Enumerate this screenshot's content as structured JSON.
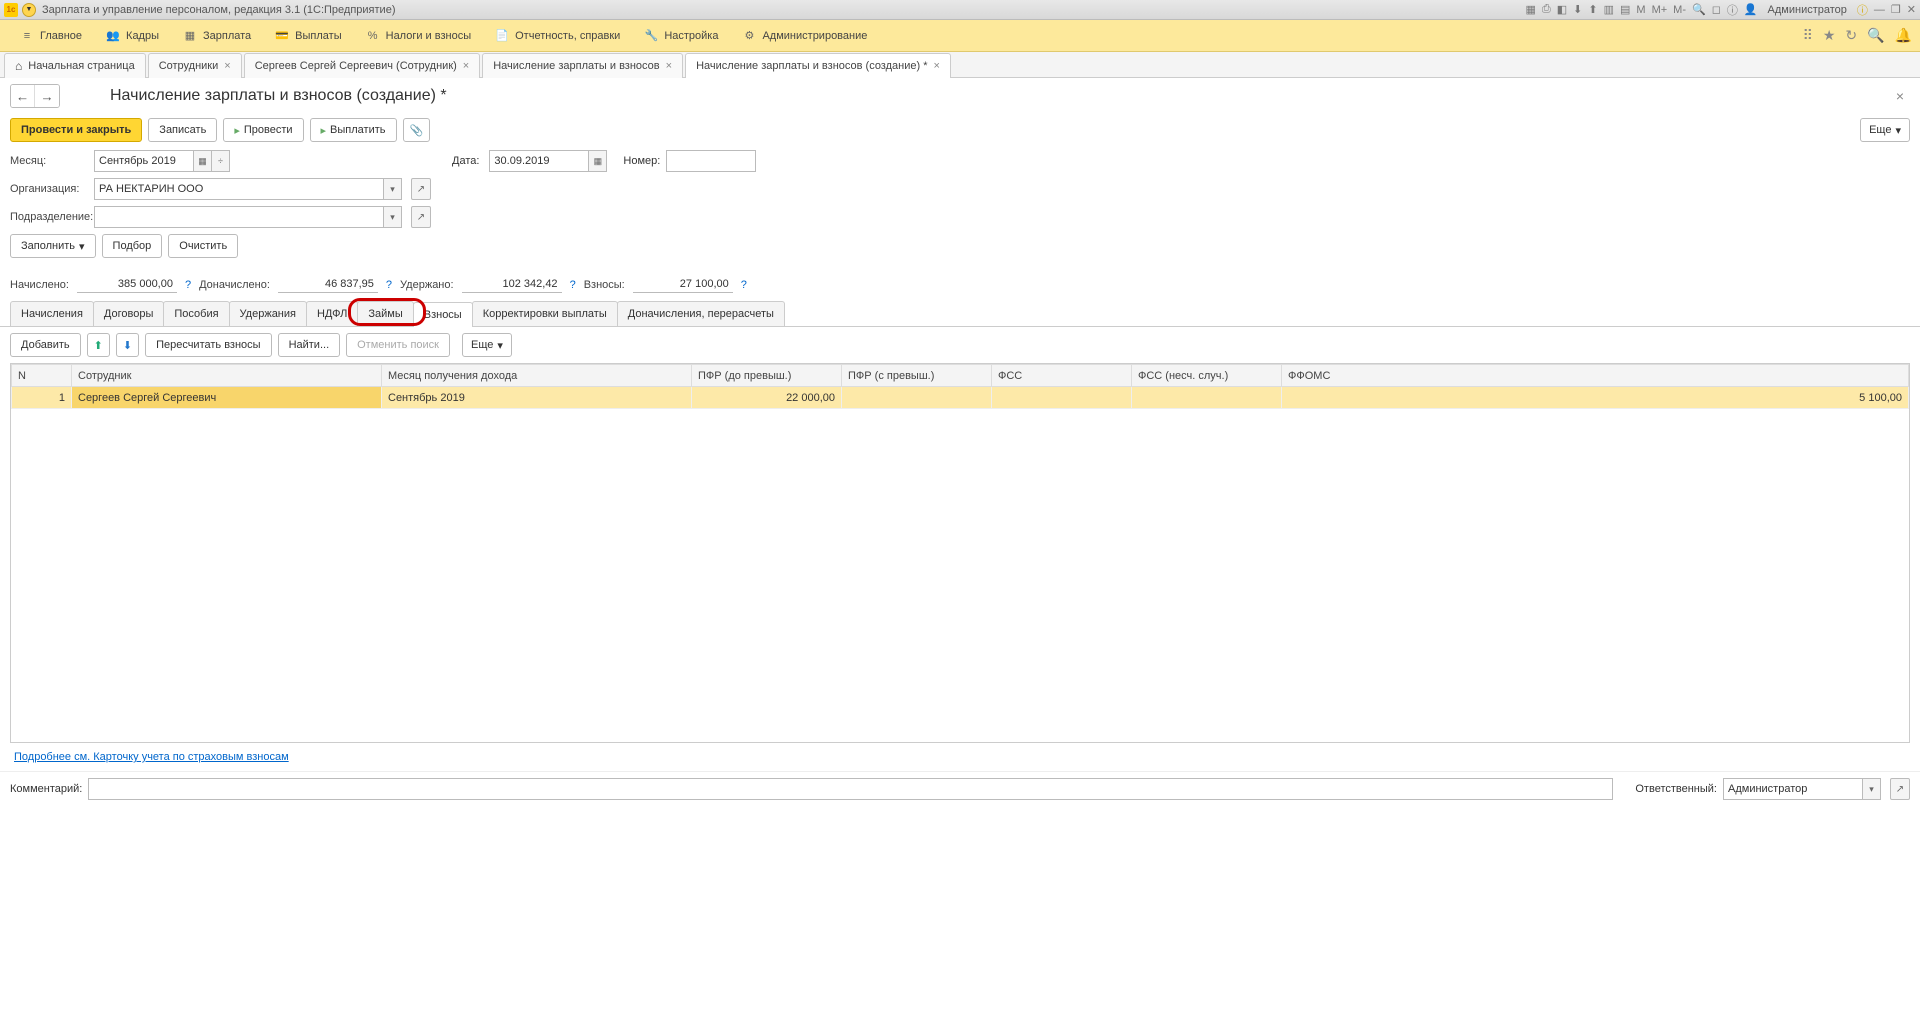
{
  "titlebar": {
    "title": "Зарплата и управление персоналом, редакция 3.1  (1С:Предприятие)",
    "user": "Администратор",
    "m_labels": [
      "M",
      "M+",
      "M-"
    ]
  },
  "mainmenu": {
    "items": [
      {
        "label": "Главное"
      },
      {
        "label": "Кадры"
      },
      {
        "label": "Зарплата"
      },
      {
        "label": "Выплаты"
      },
      {
        "label": "Налоги и взносы"
      },
      {
        "label": "Отчетность, справки"
      },
      {
        "label": "Настройка"
      },
      {
        "label": "Администрирование"
      }
    ]
  },
  "tabs": [
    {
      "label": "Начальная страница",
      "home": true,
      "closable": false
    },
    {
      "label": "Сотрудники",
      "closable": true
    },
    {
      "label": "Сергеев Сергей Сергеевич (Сотрудник)",
      "closable": true
    },
    {
      "label": "Начисление зарплаты и взносов",
      "closable": true
    },
    {
      "label": "Начисление зарплаты и взносов (создание) *",
      "closable": true,
      "active": true
    }
  ],
  "page": {
    "title": "Начисление зарплаты и взносов (создание) *"
  },
  "cmd": {
    "post_close": "Провести и закрыть",
    "save": "Записать",
    "post": "Провести",
    "pay": "Выплатить",
    "more": "Еще"
  },
  "form": {
    "month_label": "Месяц:",
    "month_value": "Сентябрь 2019",
    "date_label": "Дата:",
    "date_value": "30.09.2019",
    "number_label": "Номер:",
    "number_value": "",
    "org_label": "Организация:",
    "org_value": "РА НЕКТАРИН ООО",
    "dept_label": "Подразделение:",
    "dept_value": ""
  },
  "fill_buttons": {
    "fill": "Заполнить",
    "select": "Подбор",
    "clear": "Очистить"
  },
  "totals": {
    "accrued_label": "Начислено:",
    "accrued": "385 000,00",
    "extra_label": "Доначислено:",
    "extra": "46 837,95",
    "withheld_label": "Удержано:",
    "withheld": "102 342,42",
    "contrib_label": "Взносы:",
    "contrib": "27 100,00"
  },
  "subtabs": [
    {
      "label": "Начисления"
    },
    {
      "label": "Договоры"
    },
    {
      "label": "Пособия"
    },
    {
      "label": "Удержания"
    },
    {
      "label": "НДФЛ"
    },
    {
      "label": "Займы"
    },
    {
      "label": "Взносы",
      "active": true,
      "highlight": true
    },
    {
      "label": "Корректировки выплаты"
    },
    {
      "label": "Доначисления, перерасчеты"
    }
  ],
  "tbl_toolbar": {
    "add": "Добавить",
    "recalc": "Пересчитать взносы",
    "find": "Найти...",
    "cancel_find": "Отменить поиск",
    "more": "Еще"
  },
  "table": {
    "headers": {
      "n": "N",
      "emp": "Сотрудник",
      "month": "Месяц получения дохода",
      "pfr_below": "ПФР (до превыш.)",
      "pfr_above": "ПФР (с превыш.)",
      "fss": "ФСС",
      "fss_acc": "ФСС (несч. случ.)",
      "ffoms": "ФФОМС"
    },
    "rows": [
      {
        "n": "1",
        "emp": "Сергеев Сергей Сергеевич",
        "month": "Сентябрь 2019",
        "pfr_below": "22 000,00",
        "pfr_above": "",
        "fss": "",
        "fss_acc": "",
        "ffoms": "5 100,00"
      }
    ]
  },
  "footer_link": "Подробнее см. Карточку учета по страховым взносам",
  "bottom": {
    "comment_label": "Комментарий:",
    "comment_value": "",
    "resp_label": "Ответственный:",
    "resp_value": "Администратор"
  }
}
